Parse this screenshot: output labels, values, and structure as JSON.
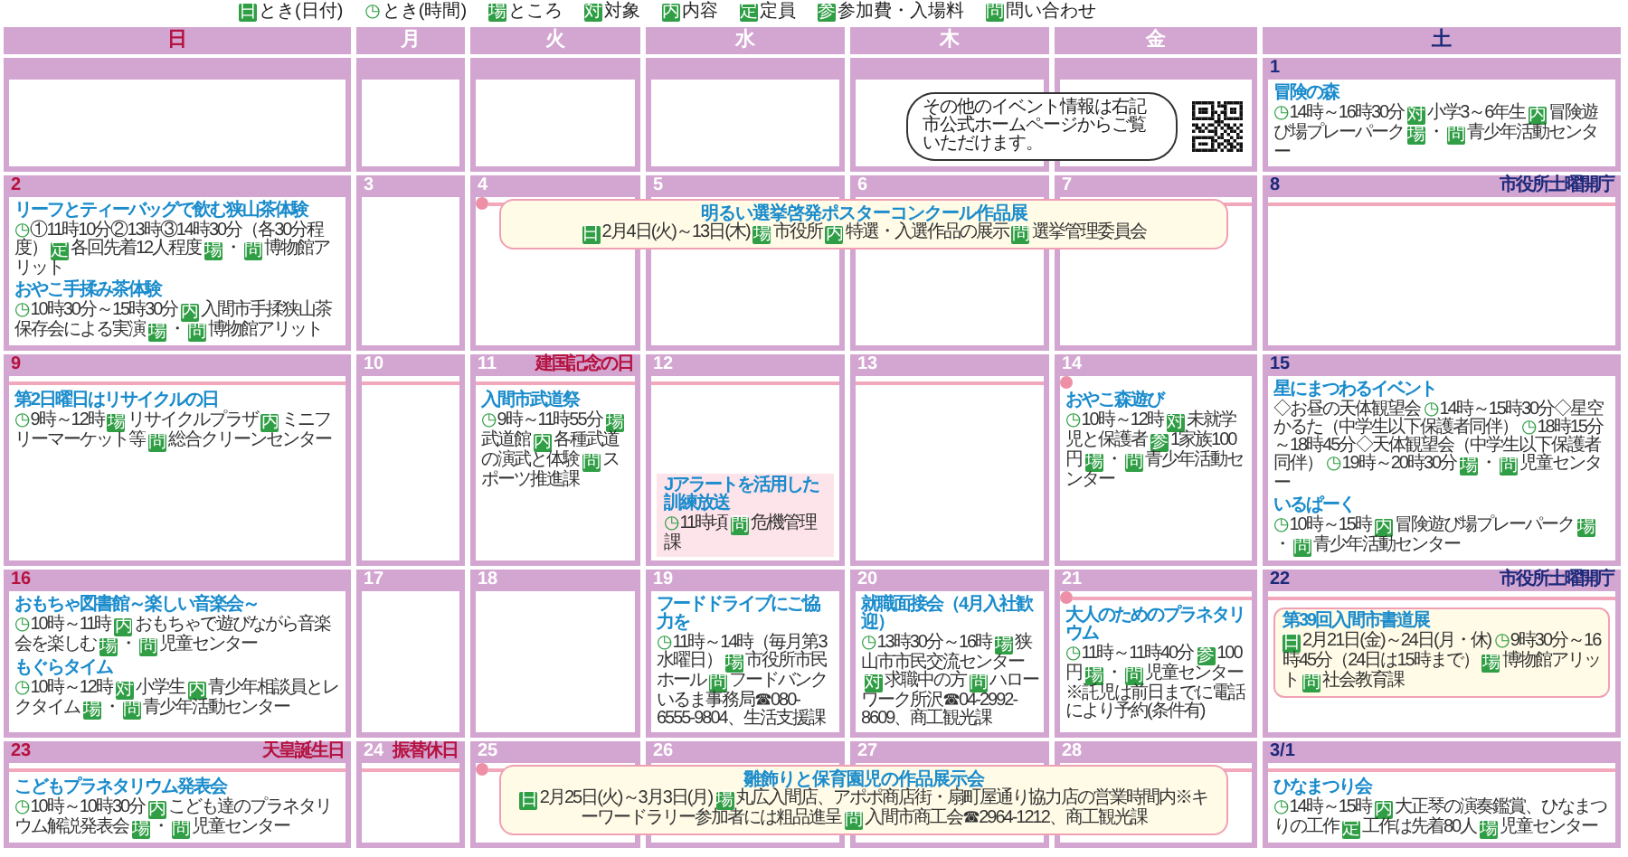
{
  "legend": [
    {
      "kind": "tag",
      "mark": "日",
      "label": "とき(日付)"
    },
    {
      "kind": "clock",
      "mark": "◷",
      "label": "とき(時間)"
    },
    {
      "kind": "tag",
      "mark": "場",
      "label": "ところ"
    },
    {
      "kind": "tag",
      "mark": "対",
      "label": "対象"
    },
    {
      "kind": "tag",
      "mark": "内",
      "label": "内容"
    },
    {
      "kind": "tag",
      "mark": "定",
      "label": "定員"
    },
    {
      "kind": "tag",
      "mark": "参",
      "label": "参加費・入場料"
    },
    {
      "kind": "tag",
      "mark": "問",
      "label": "問い合わせ"
    }
  ],
  "weekdays": [
    {
      "label": "日",
      "kind": "sunday"
    },
    {
      "label": "月",
      "kind": "weekday"
    },
    {
      "label": "火",
      "kind": "weekday"
    },
    {
      "label": "水",
      "kind": "weekday"
    },
    {
      "label": "木",
      "kind": "weekday"
    },
    {
      "label": "金",
      "kind": "weekday"
    },
    {
      "label": "土",
      "kind": "saturday"
    }
  ],
  "weeks": [
    {
      "note": {
        "text": "その他のイベント情報は右記市公式ホームページからご覧いただけます。"
      },
      "days": [
        {
          "on_line": false,
          "line_dot": false
        },
        {
          "on_line": false,
          "line_dot": false
        },
        {
          "on_line": false,
          "line_dot": false
        },
        {
          "on_line": false,
          "line_dot": false
        },
        {
          "on_line": false,
          "line_dot": false
        },
        {
          "on_line": false,
          "line_dot": false
        },
        {
          "day": "1",
          "kind": "saturday",
          "on_line": false,
          "line_dot": false,
          "events": [
            {
              "title": "冒険の森",
              "kind": "plain",
              "body": [
                {
                  "kind": "clock",
                  "mark": "◷"
                },
                {
                  "kind": "text",
                  "text": "14時～16時30分"
                },
                {
                  "kind": "tag",
                  "mark": "対"
                },
                {
                  "kind": "text",
                  "text": "小学3～6年生"
                },
                {
                  "kind": "tag",
                  "mark": "内"
                },
                {
                  "kind": "text",
                  "text": "冒険遊び場プレーパーク"
                },
                {
                  "kind": "tag",
                  "mark": "場"
                },
                {
                  "kind": "text",
                  "text": "・"
                },
                {
                  "kind": "tag",
                  "mark": "問"
                },
                {
                  "kind": "text",
                  "text": "青少年活動センター"
                }
              ]
            }
          ]
        }
      ]
    },
    {
      "banner": {
        "title": "明るい選挙啓発ポスターコンクール作品展",
        "body": [
          {
            "kind": "tag",
            "mark": "日"
          },
          {
            "kind": "text",
            "text": "2月4日(火)～13日(木)"
          },
          {
            "kind": "tag",
            "mark": "場"
          },
          {
            "kind": "text",
            "text": "市役所"
          },
          {
            "kind": "tag",
            "mark": "内"
          },
          {
            "kind": "text",
            "text": "特選・入選作品の展示"
          },
          {
            "kind": "tag",
            "mark": "問"
          },
          {
            "kind": "text",
            "text": "選挙管理委員会"
          }
        ]
      },
      "days": [
        {
          "day": "2",
          "kind": "sunday",
          "on_line": false,
          "line_dot": false,
          "in_banner": false,
          "events": [
            {
              "title": "リーフとティーバッグで飲む狭山茶体験",
              "kind": "plain",
              "body": [
                {
                  "kind": "clock",
                  "mark": "◷"
                },
                {
                  "kind": "text",
                  "text": "①11時10分②13時③14時30分（各30分程度）"
                },
                {
                  "kind": "tag",
                  "mark": "定"
                },
                {
                  "kind": "text",
                  "text": "各回先着12人程度"
                },
                {
                  "kind": "tag",
                  "mark": "場"
                },
                {
                  "kind": "text",
                  "text": "・"
                },
                {
                  "kind": "tag",
                  "mark": "問"
                },
                {
                  "kind": "text",
                  "text": "博物館アリット"
                }
              ]
            },
            {
              "title": "おやこ手揉み茶体験",
              "kind": "plain",
              "body": [
                {
                  "kind": "clock",
                  "mark": "◷"
                },
                {
                  "kind": "text",
                  "text": "10時30分～15時30分"
                },
                {
                  "kind": "tag",
                  "mark": "内"
                },
                {
                  "kind": "text",
                  "text": "入間市手揉狭山茶保存会による実演"
                },
                {
                  "kind": "tag",
                  "mark": "場"
                },
                {
                  "kind": "text",
                  "text": "・"
                },
                {
                  "kind": "tag",
                  "mark": "問"
                },
                {
                  "kind": "text",
                  "text": "博物館アリット"
                }
              ]
            }
          ]
        },
        {
          "day": "3",
          "kind": "weekday",
          "on_line": false,
          "line_dot": false,
          "in_banner": false
        },
        {
          "day": "4",
          "kind": "weekday",
          "on_line": true,
          "line_dot": true,
          "in_banner": true
        },
        {
          "day": "5",
          "kind": "weekday",
          "on_line": true,
          "line_dot": false,
          "in_banner": true
        },
        {
          "day": "6",
          "kind": "weekday",
          "on_line": true,
          "line_dot": false,
          "in_banner": true
        },
        {
          "day": "7",
          "kind": "weekday",
          "on_line": true,
          "line_dot": false,
          "in_banner": true
        },
        {
          "day": "8",
          "kind": "saturday",
          "label": {
            "text": "市役所土曜開庁",
            "kind": "office"
          },
          "on_line": true,
          "line_dot": false,
          "in_banner": false
        }
      ]
    },
    {
      "days": [
        {
          "day": "9",
          "kind": "sunday",
          "on_line": true,
          "line_dot": false,
          "events": [
            {
              "title": "第2日曜日はリサイクルの日",
              "kind": "plain",
              "body": [
                {
                  "kind": "clock",
                  "mark": "◷"
                },
                {
                  "kind": "text",
                  "text": "9時～12時"
                },
                {
                  "kind": "tag",
                  "mark": "場"
                },
                {
                  "kind": "text",
                  "text": "リサイクルプラザ"
                },
                {
                  "kind": "tag",
                  "mark": "内"
                },
                {
                  "kind": "text",
                  "text": "ミニフリーマーケット等"
                },
                {
                  "kind": "tag",
                  "mark": "問"
                },
                {
                  "kind": "text",
                  "text": "総合クリーンセンター"
                }
              ]
            }
          ]
        },
        {
          "day": "10",
          "kind": "weekday",
          "on_line": true,
          "line_dot": false
        },
        {
          "day": "11",
          "kind": "weekday",
          "label": {
            "text": "建国記念の日",
            "kind": "holiday"
          },
          "on_line": true,
          "line_dot": false,
          "events": [
            {
              "title": "入間市武道祭",
              "kind": "plain",
              "body": [
                {
                  "kind": "clock",
                  "mark": "◷"
                },
                {
                  "kind": "text",
                  "text": "9時～11時55分"
                },
                {
                  "kind": "tag",
                  "mark": "場"
                },
                {
                  "kind": "text",
                  "text": "武道館"
                },
                {
                  "kind": "tag",
                  "mark": "内"
                },
                {
                  "kind": "text",
                  "text": "各種武道の演武と体験"
                },
                {
                  "kind": "tag",
                  "mark": "問"
                },
                {
                  "kind": "text",
                  "text": "スポーツ推進課"
                }
              ]
            }
          ]
        },
        {
          "day": "12",
          "kind": "weekday",
          "on_line": true,
          "line_dot": false,
          "events": [
            {
              "title": "Jアラートを活用した訓練放送",
              "kind": "alert",
              "body": [
                {
                  "kind": "clock",
                  "mark": "◷"
                },
                {
                  "kind": "text",
                  "text": "11時頃"
                },
                {
                  "kind": "tag",
                  "mark": "問"
                },
                {
                  "kind": "text",
                  "text": "危機管理課"
                }
              ]
            }
          ]
        },
        {
          "day": "13",
          "kind": "weekday",
          "on_line": true,
          "line_dot": false
        },
        {
          "day": "14",
          "kind": "weekday",
          "on_line": false,
          "line_dot": true,
          "events": [
            {
              "title": "おやこ森遊び",
              "kind": "plain",
              "body": [
                {
                  "kind": "clock",
                  "mark": "◷"
                },
                {
                  "kind": "text",
                  "text": "10時～12時"
                },
                {
                  "kind": "tag",
                  "mark": "対"
                },
                {
                  "kind": "text",
                  "text": "未就学児と保護者"
                },
                {
                  "kind": "tag",
                  "mark": "参"
                },
                {
                  "kind": "text",
                  "text": "1家族100円"
                },
                {
                  "kind": "tag",
                  "mark": "場"
                },
                {
                  "kind": "text",
                  "text": "・"
                },
                {
                  "kind": "tag",
                  "mark": "問"
                },
                {
                  "kind": "text",
                  "text": "青少年活動センター"
                }
              ]
            }
          ]
        },
        {
          "day": "15",
          "kind": "saturday",
          "on_line": false,
          "line_dot": false,
          "events": [
            {
              "title": "星にまつわるイベント",
              "kind": "plain",
              "body": [
                {
                  "kind": "text",
                  "text": "◇お昼の天体観望会"
                },
                {
                  "kind": "clock",
                  "mark": "◷"
                },
                {
                  "kind": "text",
                  "text": "14時～15時30分"
                },
                {
                  "kind": "text",
                  "text": "◇星空かるた（中学生以下保護者同伴）"
                },
                {
                  "kind": "clock",
                  "mark": "◷"
                },
                {
                  "kind": "text",
                  "text": "18時15分～18時45分"
                },
                {
                  "kind": "text",
                  "text": "◇天体観望会（中学生以下保護者同伴）"
                },
                {
                  "kind": "clock",
                  "mark": "◷"
                },
                {
                  "kind": "text",
                  "text": "19時～20時30分"
                },
                {
                  "kind": "tag",
                  "mark": "場"
                },
                {
                  "kind": "text",
                  "text": "・"
                },
                {
                  "kind": "tag",
                  "mark": "問"
                },
                {
                  "kind": "text",
                  "text": "児童センター"
                }
              ]
            },
            {
              "title": "いるぱーく",
              "kind": "plain",
              "body": [
                {
                  "kind": "clock",
                  "mark": "◷"
                },
                {
                  "kind": "text",
                  "text": "10時～15時"
                },
                {
                  "kind": "tag",
                  "mark": "内"
                },
                {
                  "kind": "text",
                  "text": "冒険遊び場プレーパーク"
                },
                {
                  "kind": "tag",
                  "mark": "場"
                },
                {
                  "kind": "text",
                  "text": "・"
                },
                {
                  "kind": "tag",
                  "mark": "問"
                },
                {
                  "kind": "text",
                  "text": "青少年活動センター"
                }
              ]
            }
          ]
        }
      ]
    },
    {
      "days": [
        {
          "day": "16",
          "kind": "sunday",
          "on_line": false,
          "line_dot": false,
          "events": [
            {
              "title": "おもちゃ図書館～楽しい音楽会～",
              "kind": "plain",
              "body": [
                {
                  "kind": "clock",
                  "mark": "◷"
                },
                {
                  "kind": "text",
                  "text": "10時～11時"
                },
                {
                  "kind": "tag",
                  "mark": "内"
                },
                {
                  "kind": "text",
                  "text": "おもちゃで遊びながら音楽会を楽しむ"
                },
                {
                  "kind": "tag",
                  "mark": "場"
                },
                {
                  "kind": "text",
                  "text": "・"
                },
                {
                  "kind": "tag",
                  "mark": "問"
                },
                {
                  "kind": "text",
                  "text": "児童センター"
                }
              ]
            },
            {
              "title": "もぐらタイム",
              "kind": "plain",
              "body": [
                {
                  "kind": "clock",
                  "mark": "◷"
                },
                {
                  "kind": "text",
                  "text": "10時～12時"
                },
                {
                  "kind": "tag",
                  "mark": "対"
                },
                {
                  "kind": "text",
                  "text": "小学生"
                },
                {
                  "kind": "tag",
                  "mark": "内"
                },
                {
                  "kind": "text",
                  "text": "青少年相談員とレクタイム"
                },
                {
                  "kind": "tag",
                  "mark": "場"
                },
                {
                  "kind": "text",
                  "text": "・"
                },
                {
                  "kind": "tag",
                  "mark": "問"
                },
                {
                  "kind": "text",
                  "text": "青少年活動センター"
                }
              ]
            }
          ]
        },
        {
          "day": "17",
          "kind": "weekday",
          "on_line": false,
          "line_dot": false
        },
        {
          "day": "18",
          "kind": "weekday",
          "on_line": false,
          "line_dot": false
        },
        {
          "day": "19",
          "kind": "weekday",
          "on_line": false,
          "line_dot": false,
          "events": [
            {
              "title": "フードドライブにご協力を",
              "kind": "plain",
              "body": [
                {
                  "kind": "clock",
                  "mark": "◷"
                },
                {
                  "kind": "text",
                  "text": "11時～14時（毎月第3水曜日）"
                },
                {
                  "kind": "tag",
                  "mark": "場"
                },
                {
                  "kind": "text",
                  "text": "市役所市民ホール"
                },
                {
                  "kind": "tag",
                  "mark": "問"
                },
                {
                  "kind": "text",
                  "text": "フードバンクいるま事務局☎080-6555-9804、生活支援課"
                }
              ]
            }
          ]
        },
        {
          "day": "20",
          "kind": "weekday",
          "on_line": false,
          "line_dot": false,
          "events": [
            {
              "title": "就職面接会（4月入社歓迎）",
              "kind": "plain",
              "body": [
                {
                  "kind": "clock",
                  "mark": "◷"
                },
                {
                  "kind": "text",
                  "text": "13時30分～16時"
                },
                {
                  "kind": "tag",
                  "mark": "場"
                },
                {
                  "kind": "text",
                  "text": "狭山市市民交流センター"
                },
                {
                  "kind": "tag",
                  "mark": "対"
                },
                {
                  "kind": "text",
                  "text": "求職中の方"
                },
                {
                  "kind": "tag",
                  "mark": "問"
                },
                {
                  "kind": "text",
                  "text": "ハローワーク所沢☎04-2992-8609、商工観光課"
                }
              ]
            }
          ]
        },
        {
          "day": "21",
          "kind": "weekday",
          "on_line": true,
          "line_dot": true,
          "events": [
            {
              "title": "大人のためのプラネタリウム",
              "kind": "plain",
              "body": [
                {
                  "kind": "clock",
                  "mark": "◷"
                },
                {
                  "kind": "text",
                  "text": "11時～11時40分"
                },
                {
                  "kind": "tag",
                  "mark": "参"
                },
                {
                  "kind": "text",
                  "text": "100円"
                },
                {
                  "kind": "tag",
                  "mark": "場"
                },
                {
                  "kind": "text",
                  "text": "・"
                },
                {
                  "kind": "tag",
                  "mark": "問"
                },
                {
                  "kind": "text",
                  "text": "児童センター"
                },
                {
                  "kind": "text",
                  "text": "※託児は前日までに電話により予約(条件有)"
                }
              ]
            }
          ]
        },
        {
          "day": "22",
          "kind": "saturday",
          "label": {
            "text": "市役所土曜開庁",
            "kind": "office"
          },
          "on_line": true,
          "line_dot": false,
          "events": [
            {
              "title": "第39回入間市書道展",
              "kind": "boxed",
              "body": [
                {
                  "kind": "tag",
                  "mark": "日"
                },
                {
                  "kind": "text",
                  "text": "2月21日(金)～24日(月・休)"
                },
                {
                  "kind": "clock",
                  "mark": "◷"
                },
                {
                  "kind": "text",
                  "text": "9時30分～16時45分（24日は15時まで）"
                },
                {
                  "kind": "tag",
                  "mark": "場"
                },
                {
                  "kind": "text",
                  "text": "博物館アリット"
                },
                {
                  "kind": "tag",
                  "mark": "問"
                },
                {
                  "kind": "text",
                  "text": "社会教育課"
                }
              ]
            }
          ]
        }
      ]
    },
    {
      "banner": {
        "title": "雛飾りと保育園児の作品展示会",
        "body": [
          {
            "kind": "tag",
            "mark": "日"
          },
          {
            "kind": "text",
            "text": "2月25日(火)～3月3日(月)"
          },
          {
            "kind": "tag",
            "mark": "場"
          },
          {
            "kind": "text",
            "text": "丸広入間店、アポポ商店街・扇町屋通り協力店の営業時間内"
          },
          {
            "kind": "text",
            "text": "※キーワードラリー参加者には粗品進呈"
          },
          {
            "kind": "tag",
            "mark": "問"
          },
          {
            "kind": "text",
            "text": "入間市商工会☎2964-1212、商工観光課"
          }
        ]
      },
      "days": [
        {
          "day": "23",
          "kind": "sunday",
          "label": {
            "text": "天皇誕生日",
            "kind": "holiday"
          },
          "on_line": true,
          "line_dot": false,
          "in_banner": false,
          "events": [
            {
              "title": "こどもプラネタリウム発表会",
              "kind": "plain",
              "body": [
                {
                  "kind": "clock",
                  "mark": "◷"
                },
                {
                  "kind": "text",
                  "text": "10時～10時30分"
                },
                {
                  "kind": "tag",
                  "mark": "内"
                },
                {
                  "kind": "text",
                  "text": "こども達のプラネタリウム解説発表会"
                },
                {
                  "kind": "tag",
                  "mark": "場"
                },
                {
                  "kind": "text",
                  "text": "・"
                },
                {
                  "kind": "tag",
                  "mark": "問"
                },
                {
                  "kind": "text",
                  "text": "児童センター"
                }
              ]
            }
          ]
        },
        {
          "day": "24",
          "kind": "weekday",
          "label": {
            "text": "振替休日",
            "kind": "holiday"
          },
          "on_line": true,
          "line_dot": false,
          "in_banner": false
        },
        {
          "day": "25",
          "kind": "weekday",
          "on_line": true,
          "line_dot": true,
          "in_banner": true
        },
        {
          "day": "26",
          "kind": "weekday",
          "on_line": true,
          "line_dot": false,
          "in_banner": true
        },
        {
          "day": "27",
          "kind": "weekday",
          "on_line": true,
          "line_dot": false,
          "in_banner": true
        },
        {
          "day": "28",
          "kind": "weekday",
          "on_line": true,
          "line_dot": false,
          "in_banner": true
        },
        {
          "day": "3/1",
          "kind": "saturday",
          "on_line": true,
          "line_dot": false,
          "in_banner": false,
          "events": [
            {
              "title": "ひなまつり会",
              "kind": "plain",
              "body": [
                {
                  "kind": "clock",
                  "mark": "◷"
                },
                {
                  "kind": "text",
                  "text": "14時～15時"
                },
                {
                  "kind": "tag",
                  "mark": "内"
                },
                {
                  "kind": "text",
                  "text": "大正琴の演奏鑑賞、ひなまつりの工作"
                },
                {
                  "kind": "tag",
                  "mark": "定"
                },
                {
                  "kind": "text",
                  "text": "工作は先着80人"
                },
                {
                  "kind": "tag",
                  "mark": "場"
                },
                {
                  "kind": "text",
                  "text": "児童センター"
                }
              ]
            }
          ]
        }
      ]
    }
  ]
}
